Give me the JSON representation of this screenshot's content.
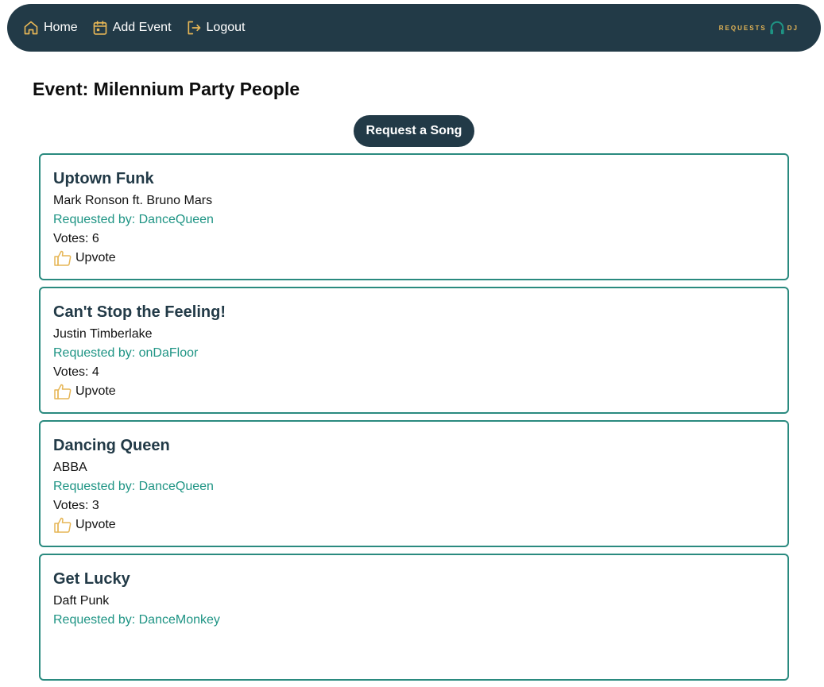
{
  "nav": {
    "home_label": "Home",
    "add_event_label": "Add Event",
    "logout_label": "Logout",
    "logo_left": "REQUESTS",
    "logo_right": "DJ"
  },
  "colors": {
    "nav_bg": "#223a47",
    "accent_gold": "#e6b656",
    "card_border": "#2a8a7f",
    "requester_text": "#1e9484"
  },
  "page": {
    "title": "Event: Milennium Party People",
    "request_button_label": "Request a Song"
  },
  "songs": [
    {
      "title": "Uptown Funk",
      "artist": "Mark Ronson ft. Bruno Mars",
      "requested_by": "Requested by: DanceQueen",
      "votes": "Votes: 6",
      "upvote_label": "Upvote"
    },
    {
      "title": "Can't Stop the Feeling!",
      "artist": "Justin Timberlake",
      "requested_by": "Requested by: onDaFloor",
      "votes": "Votes: 4",
      "upvote_label": "Upvote"
    },
    {
      "title": "Dancing Queen",
      "artist": "ABBA",
      "requested_by": "Requested by: DanceQueen",
      "votes": "Votes: 3",
      "upvote_label": "Upvote"
    },
    {
      "title": "Get Lucky",
      "artist": "Daft Punk",
      "requested_by": "Requested by: DanceMonkey",
      "votes": "",
      "upvote_label": ""
    }
  ]
}
